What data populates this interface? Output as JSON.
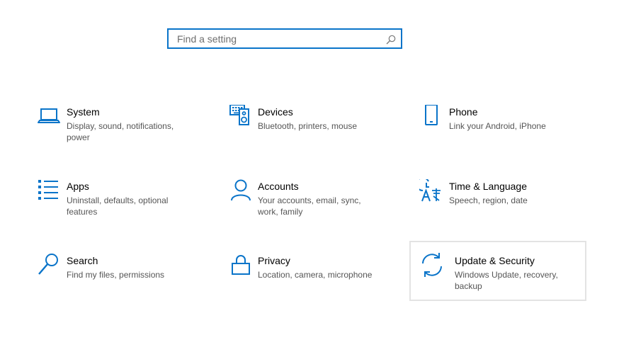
{
  "search": {
    "placeholder": "Find a setting"
  },
  "tiles": [
    {
      "title": "System",
      "description": "Display, sound, notifications, power",
      "icon": "laptop-icon"
    },
    {
      "title": "Devices",
      "description": "Bluetooth, printers, mouse",
      "icon": "keyboard-speaker-icon"
    },
    {
      "title": "Phone",
      "description": "Link your Android, iPhone",
      "icon": "phone-icon"
    },
    {
      "title": "Apps",
      "description": "Uninstall, defaults, optional features",
      "icon": "apps-list-icon"
    },
    {
      "title": "Accounts",
      "description": "Your accounts, email, sync, work, family",
      "icon": "person-icon"
    },
    {
      "title": "Time & Language",
      "description": "Speech, region, date",
      "icon": "time-language-icon"
    },
    {
      "title": "Search",
      "description": "Find my files, permissions",
      "icon": "magnifier-icon"
    },
    {
      "title": "Privacy",
      "description": "Location, camera, microphone",
      "icon": "lock-icon"
    },
    {
      "title": "Update & Security",
      "description": "Windows Update, recovery, backup",
      "icon": "sync-arrows-icon"
    }
  ],
  "colors": {
    "accent": "#0a74c9",
    "hover_border": "#e3e3e3",
    "description_text": "#555555"
  }
}
